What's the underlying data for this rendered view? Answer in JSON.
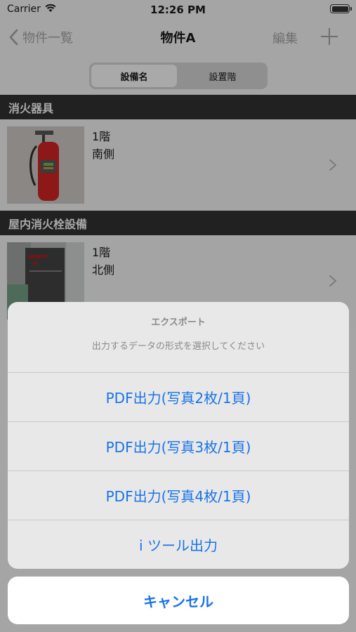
{
  "status_bar": {
    "carrier": "Carrier",
    "time": "12:26 PM"
  },
  "nav": {
    "back_label": "物件一覧",
    "title": "物件A",
    "edit_label": "編集"
  },
  "segments": [
    {
      "label": "設備名",
      "selected": true
    },
    {
      "label": "設置階",
      "selected": false
    }
  ],
  "sections": [
    {
      "header": "消火器具",
      "items": [
        {
          "floor": "1階",
          "location": "南側",
          "image": "fire-extinguisher"
        }
      ]
    },
    {
      "header": "屋内消火栓設備",
      "items": [
        {
          "floor": "1階",
          "location": "北側",
          "image": "indoor-fire-hydrant"
        }
      ]
    }
  ],
  "action_sheet": {
    "title": "エクスポート",
    "message": "出力するデータの形式を選択してください",
    "options": [
      "PDF出力(写真2枚/1頁)",
      "PDF出力(写真3枚/1頁)",
      "PDF出力(写真4枚/1頁)",
      "i ツール出力"
    ],
    "cancel": "キャンセル"
  },
  "colors": {
    "action_blue": "#1a73e8",
    "section_header_bg": "#212121"
  }
}
